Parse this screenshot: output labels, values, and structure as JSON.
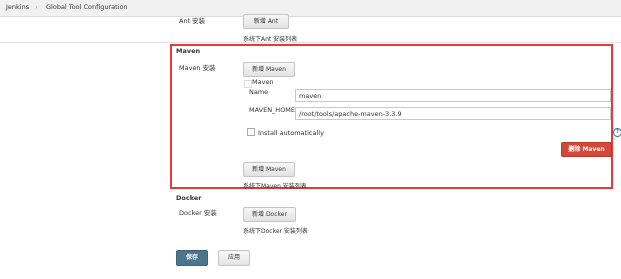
{
  "breadcrumb": {
    "items": [
      "Jenkins",
      "Global Tool Configuration"
    ],
    "separator": "›"
  },
  "ant": {
    "label": "Ant 安装",
    "add_button": "新增 Ant",
    "hint": "系统下Ant 安装列表"
  },
  "maven": {
    "section_title": "Maven",
    "label": "Maven 安装",
    "add_button_top": "新增 Maven",
    "entry_title": "Maven",
    "name_label": "Name",
    "name_value": "maven",
    "home_label": "MAVEN_HOME",
    "home_value": "/root/tools/apache-maven-3.3.9",
    "install_auto_label": "Install automatically",
    "delete_button": "删除 Maven",
    "add_button_bottom": "新增 Maven",
    "hint": "系统下Maven 安装列表",
    "help_icon": "?"
  },
  "docker": {
    "section_title": "Docker",
    "label": "Docker 安装",
    "add_button": "新增 Docker",
    "hint": "系统下Docker 安装列表"
  },
  "footer": {
    "save_label": "保存",
    "apply_label": "应用"
  },
  "colors": {
    "accent_red": "#d24939",
    "highlight_box": "#e33b3b",
    "save_blue": "#4b758b"
  }
}
